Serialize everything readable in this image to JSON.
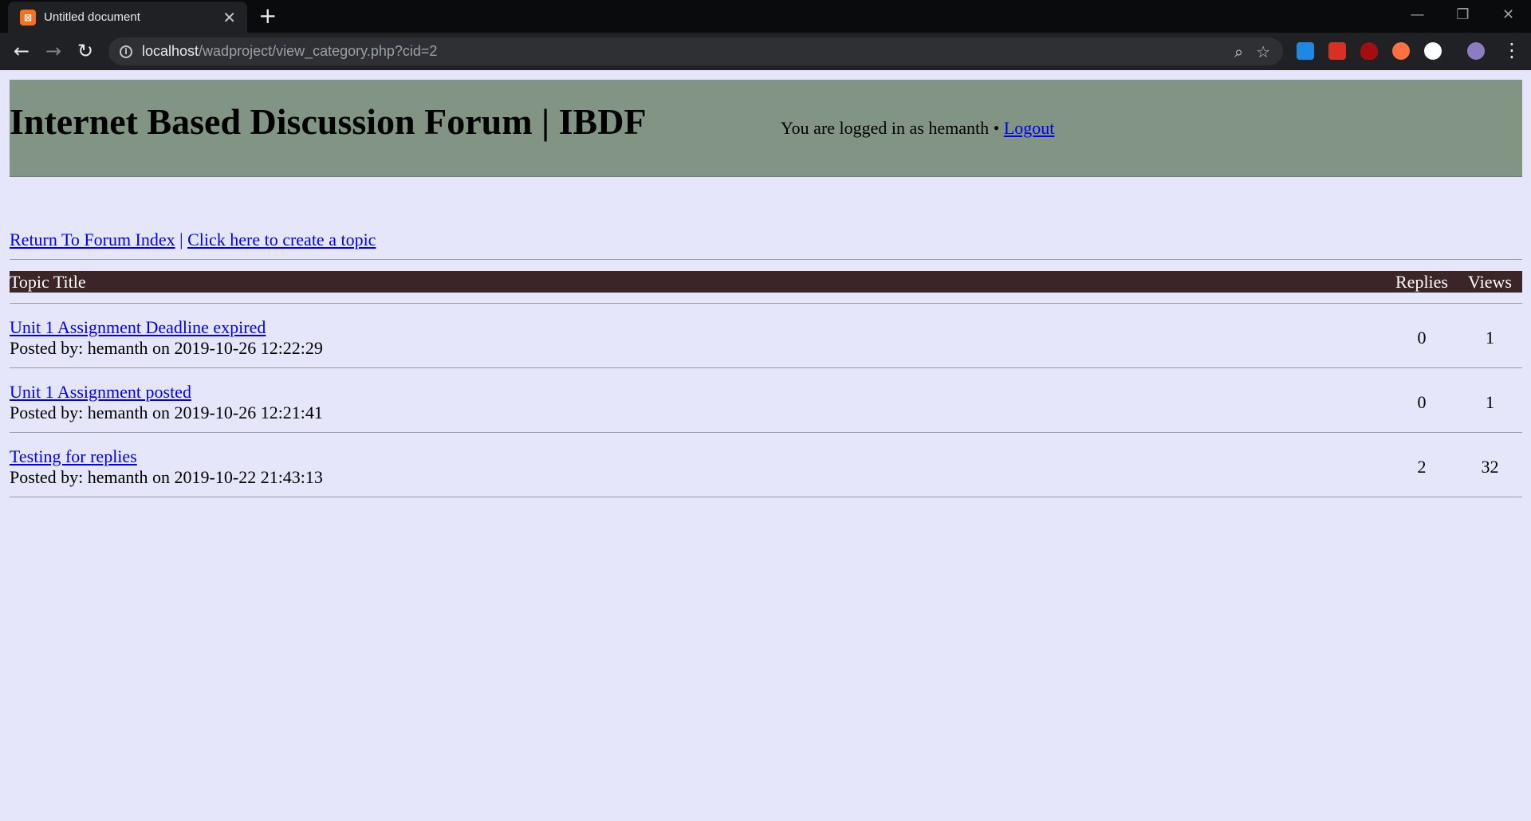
{
  "browser": {
    "tab_title": "Untitled document",
    "url_host": "localhost",
    "url_path": "/wadproject/view_category.php?cid=2"
  },
  "header": {
    "site_title": "Internet Based Discussion Forum | IBDF",
    "logged_in_text": "You are logged in as hemanth •",
    "logout_label": "Logout"
  },
  "breadcrumbs": {
    "return_label": "Return To Forum Index",
    "separator": "|",
    "create_label": "Click here to create a topic"
  },
  "table": {
    "headers": {
      "title": "Topic Title",
      "replies": "Replies",
      "views": "Views"
    },
    "rows": [
      {
        "title": "Unit 1 Assignment Deadline expired",
        "meta": "Posted by: hemanth on 2019-10-26 12:22:29",
        "replies": "0",
        "views": "1"
      },
      {
        "title": "Unit 1 Assignment posted",
        "meta": "Posted by: hemanth on 2019-10-26 12:21:41",
        "replies": "0",
        "views": "1"
      },
      {
        "title": "Testing for replies",
        "meta": "Posted by: hemanth on 2019-10-22 21:43:13",
        "replies": "2",
        "views": "32"
      }
    ]
  }
}
